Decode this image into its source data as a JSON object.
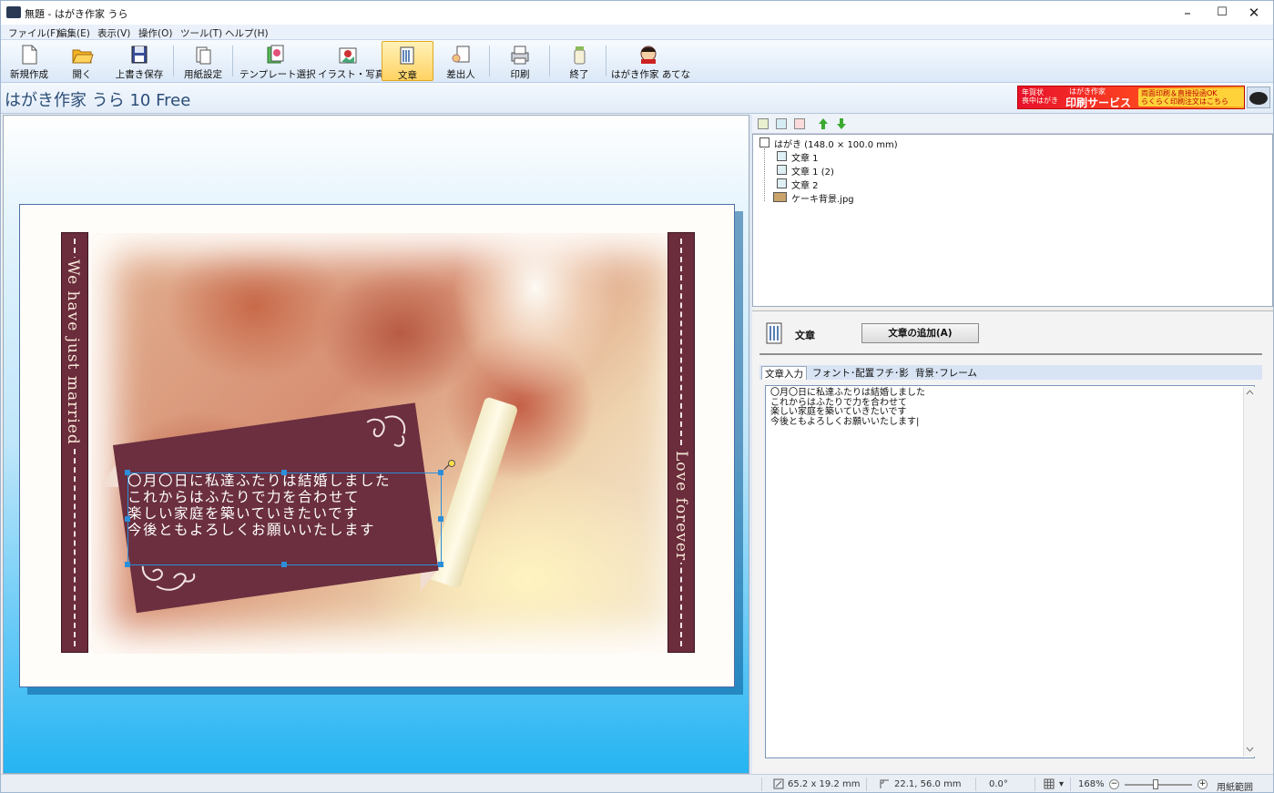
{
  "window": {
    "title": "無題 - はがき作家 うら",
    "controls": {
      "minimize": "–",
      "maximize": "☐",
      "close": "✕"
    }
  },
  "menu": [
    "ファイル(F)",
    "編集(E)",
    "表示(V)",
    "操作(O)",
    "ツール(T)",
    "ヘルプ(H)"
  ],
  "toolbar": [
    {
      "label": "新規作成",
      "icon": "new-file-icon"
    },
    {
      "label": "開く",
      "icon": "open-folder-icon"
    },
    {
      "label": "上書き保存",
      "icon": "save-icon"
    },
    {
      "label": "用紙設定",
      "icon": "paper-setup-icon"
    },
    {
      "label": "テンプレート選択",
      "icon": "template-icon"
    },
    {
      "label": "イラスト・写真",
      "icon": "illustration-icon"
    },
    {
      "label": "文章",
      "icon": "text-icon",
      "active": true
    },
    {
      "label": "差出人",
      "icon": "sender-icon"
    },
    {
      "label": "印刷",
      "icon": "printer-icon"
    },
    {
      "label": "終了",
      "icon": "exit-icon"
    },
    {
      "label": "はがき作家 あてな",
      "icon": "atena-app-icon"
    }
  ],
  "header": {
    "app_title": "はがき作家 うら 10 Free",
    "banner": {
      "left_small": "年賀状\n喪中はがき",
      "brand_small": "はがき作家",
      "main": "印刷サービス",
      "right_top": "両面印刷＆直接投函OK",
      "right_bottom": "らくらく印刷注文はこちら"
    }
  },
  "card": {
    "left_vertical_text": "We have just married",
    "right_vertical_text": "Love forever",
    "message_lines": [
      "〇月〇日に私達ふたりは結婚しました",
      "これからはふたりで力を合わせて",
      "楽しい家庭を築いていきたいです",
      "今後ともよろしくお願いいたします"
    ]
  },
  "tree": {
    "root": "はがき (148.0 × 100.0 mm)",
    "items": [
      {
        "label": "文章 1",
        "icon": "text-item-icon"
      },
      {
        "label": "文章 1 (2)",
        "icon": "text-item-icon"
      },
      {
        "label": "文章 2",
        "icon": "text-item-icon"
      },
      {
        "label": "ケーキ背景.jpg",
        "icon": "image-item-icon"
      }
    ]
  },
  "panel": {
    "label": "文章",
    "add_button": "文章の追加(A)",
    "tabs": [
      "文章入力",
      "フォント･配置",
      "フチ･影",
      "背景･フレーム"
    ],
    "active_tab": 0,
    "text_content": "〇月〇日に私達ふたりは結婚しました\nこれからはふたりで力を合わせて\n楽しい家庭を築いていきたいです\n今後ともよろしくお願いいたします|"
  },
  "status": {
    "size": "65.2 x 19.2 mm",
    "position": "22.1, 56.0 mm",
    "angle": "0.0°",
    "zoom": "168%",
    "range": "用紙範囲"
  },
  "colors": {
    "card_maroon": "#6b2c3c",
    "canvas_blue": "#25b4f2",
    "selection": "#2d8ed8",
    "active_button": "#ffd262"
  }
}
